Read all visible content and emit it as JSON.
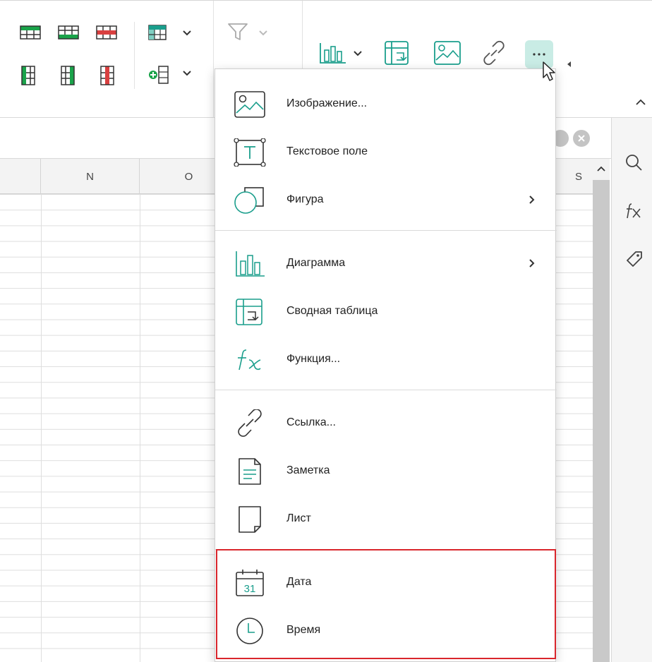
{
  "columns": [
    {
      "label": ""
    },
    {
      "label": "N"
    },
    {
      "label": "O"
    }
  ],
  "scroll_column_label": "S",
  "insert_menu": {
    "groups": [
      {
        "items": [
          {
            "label": "Изображение...",
            "icon": "image-icon",
            "submenu": false
          },
          {
            "label": "Текстовое поле",
            "icon": "text-box-icon",
            "submenu": false
          },
          {
            "label": "Фигура",
            "icon": "shape-icon",
            "submenu": true
          }
        ]
      },
      {
        "items": [
          {
            "label": "Диаграмма",
            "icon": "chart-icon",
            "submenu": true
          },
          {
            "label": "Сводная таблица",
            "icon": "pivot-table-icon",
            "submenu": false
          },
          {
            "label": "Функция...",
            "icon": "function-icon",
            "submenu": false
          }
        ]
      },
      {
        "items": [
          {
            "label": "Ссылка...",
            "icon": "link-icon",
            "submenu": false
          },
          {
            "label": "Заметка",
            "icon": "note-icon",
            "submenu": false
          },
          {
            "label": "Лист",
            "icon": "sheet-icon",
            "submenu": false
          }
        ]
      },
      {
        "items": [
          {
            "label": "Дата",
            "icon": "calendar-icon",
            "submenu": false
          },
          {
            "label": "Время",
            "icon": "clock-icon",
            "submenu": false
          }
        ]
      }
    ]
  },
  "calendar_day": "31",
  "colors": {
    "accent": "#1a9e8c",
    "more_button_bg": "#c9ece5",
    "highlight_border": "#d9262c",
    "green": "#1aa34a",
    "red": "#d94040"
  }
}
